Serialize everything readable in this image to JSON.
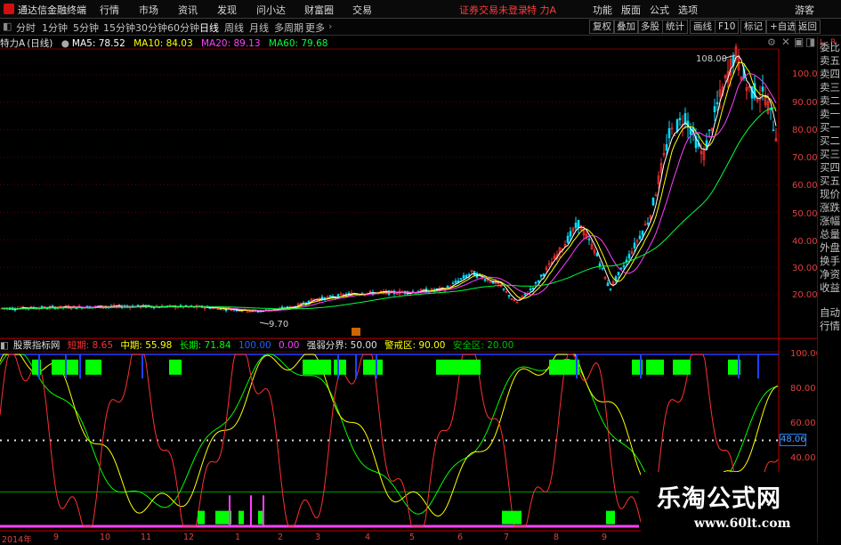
{
  "app_title": "通达信金融终端",
  "menu": [
    "行情",
    "市场",
    "资讯",
    "发现",
    "问小达",
    "财富圈",
    "交易"
  ],
  "menu_status": "证券交易未登录",
  "menu_stock": "特 力A",
  "menu_right": [
    "功能",
    "版面",
    "公式",
    "选项",
    "游客"
  ],
  "periods": [
    "分时",
    "1分钟",
    "5分钟",
    "15分钟",
    "30分钟",
    "60分钟",
    "日线",
    "周线",
    "月线",
    "多周期",
    "更多"
  ],
  "active_period": "日线",
  "toolbar_right": [
    "复权",
    "叠加",
    "多股",
    "统计",
    "画线",
    "F10",
    "标记",
    "+自选",
    "返回"
  ],
  "main_header": {
    "stock": "特力A",
    "period": "(日线)",
    "ma5": "MA5: 78.52",
    "ma10": "MA10: 84.03",
    "ma20": "MA20: 89.13",
    "ma60": "MA60: 79.68"
  },
  "main_annotations": {
    "high": "108.00",
    "low": "9.70"
  },
  "main_axis": [
    "100.00",
    "90.00",
    "80.00",
    "70.00",
    "60.00",
    "50.00",
    "40.00",
    "30.00",
    "20.00"
  ],
  "side_panel": [
    "委比",
    "卖五",
    "卖四",
    "卖三",
    "卖二",
    "卖一",
    "买一",
    "买二",
    "买三",
    "买四",
    "买五",
    "现价",
    "涨跌",
    "涨幅",
    "总量",
    "外盘",
    "换手",
    "净资",
    "收益",
    "自动",
    "行情"
  ],
  "indicator_header": {
    "name": "股票指标网",
    "short": "短期: 8.65",
    "mid": "中期: 55.98",
    "long": "长期: 71.84",
    "v1": "100.00",
    "v2": "0.00",
    "strong": "强弱分界: 50.00",
    "alert": "警戒区: 90.00",
    "safe": "安全区: 20.00"
  },
  "indicator_axis": [
    "100.00",
    "80.00",
    "60.00",
    "40.00"
  ],
  "current_value": "48.06",
  "date_axis": [
    "2014年",
    "9",
    "10",
    "11",
    "12",
    "1",
    "2",
    "3",
    "4",
    "5",
    "6",
    "7",
    "8",
    "9"
  ],
  "watermark": {
    "title": "乐淘公式网",
    "url": "www.60lt.com"
  },
  "colors": {
    "up": "#ff3232",
    "down": "#00e0ff",
    "ma5": "#ffffff",
    "ma10": "#ffff00",
    "ma20": "#ff40ff",
    "ma60": "#00ff40",
    "short": "#ff3030",
    "mid": "#ffff00",
    "long": "#00ff00",
    "axis": "#e04040",
    "green_block": "#00ff00"
  }
}
